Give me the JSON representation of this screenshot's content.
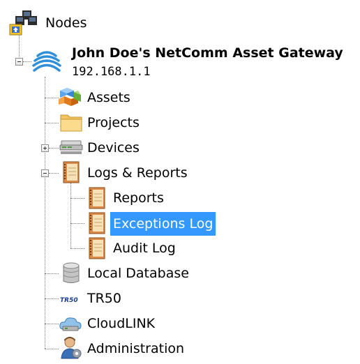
{
  "tree": {
    "root_label": "Nodes",
    "gateway": {
      "name": "John Doe's NetComm Asset Gateway",
      "ip": "192.168.1.1"
    },
    "items": [
      {
        "label": "Assets",
        "icon": "assets-cubes-icon"
      },
      {
        "label": "Projects",
        "icon": "folder-icon"
      },
      {
        "label": "Devices",
        "icon": "devices-icon"
      },
      {
        "label": "Logs & Reports",
        "icon": "notebook-icon"
      },
      {
        "label": "Local Database",
        "icon": "database-icon"
      },
      {
        "label": "TR50",
        "icon": "tr50-logo-icon"
      },
      {
        "label": "CloudLINK",
        "icon": "cloud-icon"
      },
      {
        "label": "Administration",
        "icon": "admin-user-gear-icon"
      }
    ],
    "logs_children": [
      {
        "label": "Reports",
        "icon": "notebook-icon"
      },
      {
        "label": "Exceptions Log",
        "icon": "notebook-icon",
        "selected": true
      },
      {
        "label": "Audit Log",
        "icon": "notebook-icon"
      }
    ],
    "tr50_logo_text": "TR50"
  },
  "colors": {
    "selection": "#3399ff",
    "selection_text": "#ffffff",
    "connector": "#7a7a7a"
  }
}
